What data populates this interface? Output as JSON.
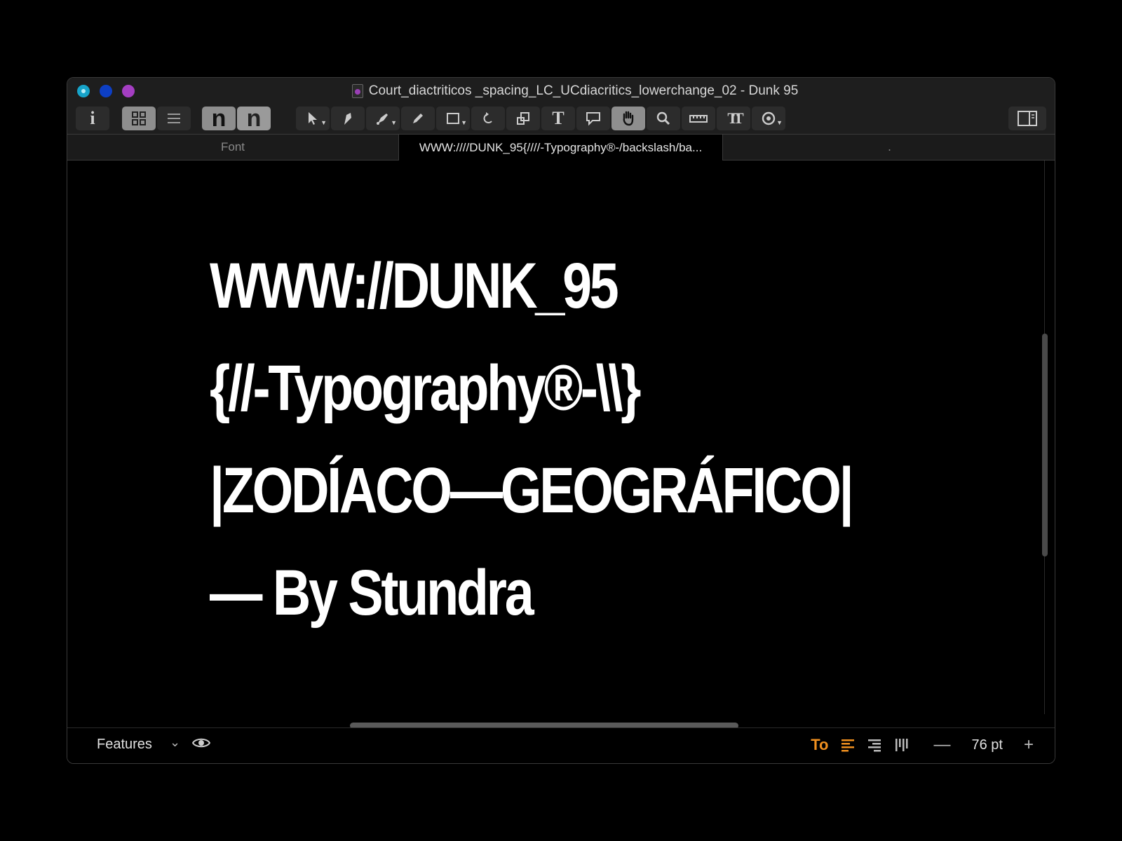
{
  "window": {
    "title": "Court_diactriticos _spacing_LC_UCdiacritics_lowerchange_02 - Dunk 95"
  },
  "toolbar": {
    "info_label": "i",
    "glyph_n_1": "n",
    "glyph_n_2": "n",
    "text_tool_label": "T",
    "tt_tool_label": "TT"
  },
  "tabs": {
    "font_label": "Font",
    "active_label": "WWW:////DUNK_95{////-Typography®-/backslash/ba...",
    "extra_label": "."
  },
  "canvas": {
    "lines": [
      "WWW://DUNK_95",
      "{//-Typography®-\\\\}",
      "|ZODÍACO—GEOGRÁFICO|",
      "— By Stundra"
    ]
  },
  "statusbar": {
    "features_label": "Features",
    "to_label": "To",
    "font_size": "76 pt"
  },
  "colors": {
    "accent_orange": "#f0901f",
    "traffic_teal": "#16a3c9",
    "traffic_blue": "#0d3fc4",
    "traffic_purple": "#a43ec2"
  }
}
